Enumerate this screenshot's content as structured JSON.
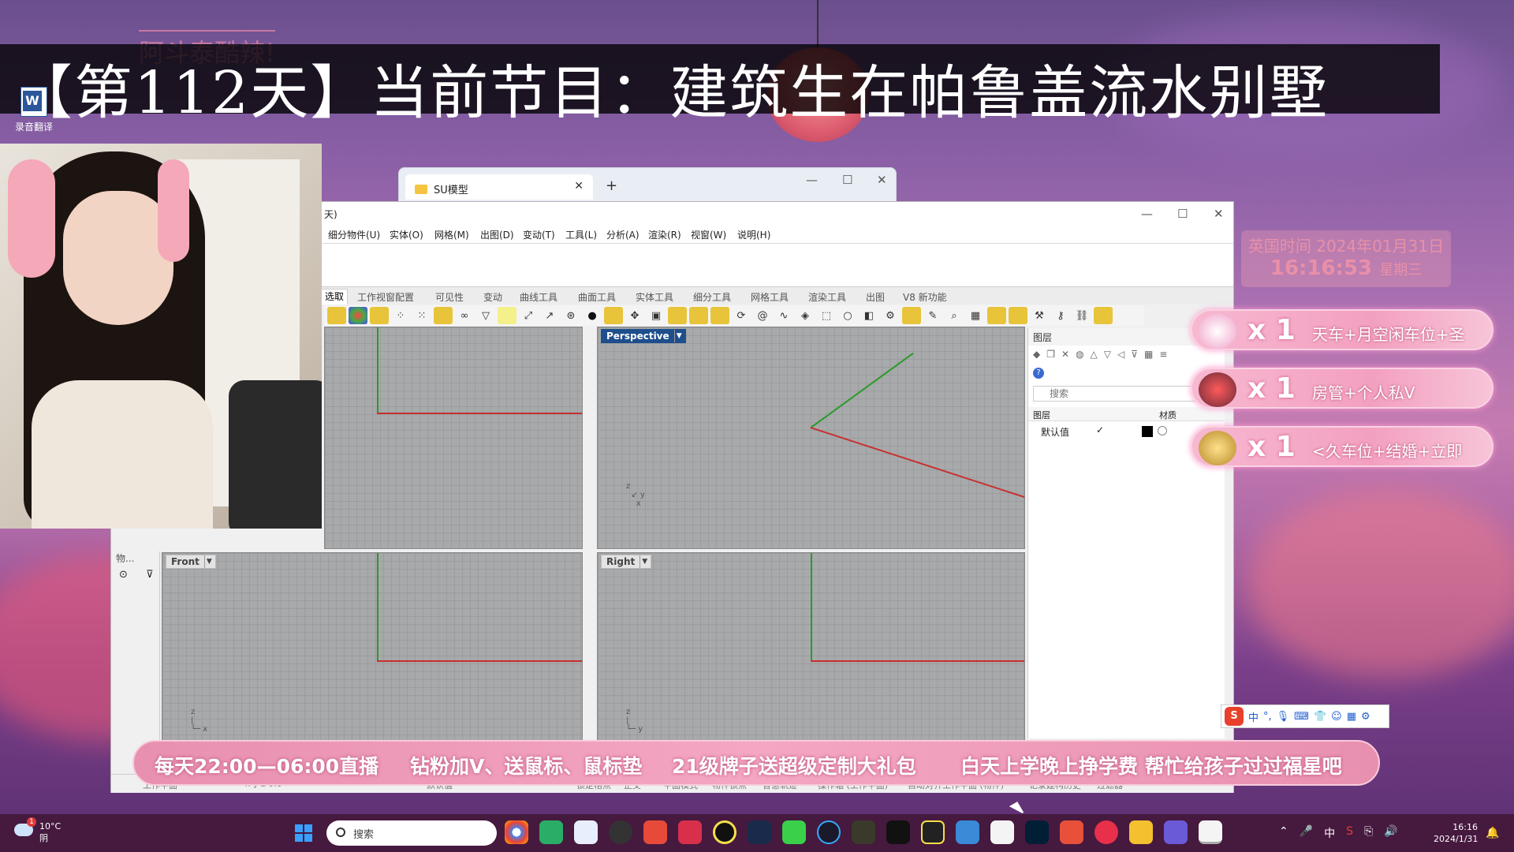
{
  "overlay": {
    "title": "【第112天】当前节目：建筑生在帕鲁盖流水别墅",
    "subtitle": "阿斗泰酷辣!"
  },
  "desktop": {
    "icon_label": "录音翻译"
  },
  "explorer": {
    "tab_label": "SU模型",
    "new_tab": "+",
    "minimize": "—",
    "maximize": "☐",
    "close": "✕"
  },
  "rhino": {
    "title_fragment": "天)",
    "menus": [
      "细分物件(U)",
      "实体(O)",
      "网格(M)",
      "出图(D)",
      "变动(T)",
      "工具(L)",
      "分析(A)",
      "渲染(R)",
      "视窗(W)",
      "说明(H)"
    ],
    "tabs": [
      "选取",
      "工作视窗配置",
      "可见性",
      "变动",
      "曲线工具",
      "曲面工具",
      "实体工具",
      "细分工具",
      "网格工具",
      "渲染工具",
      "出图",
      "V8 新功能"
    ],
    "viewports": {
      "top_left": "",
      "perspective": "Perspective",
      "front": "Front",
      "right": "Right"
    },
    "side_panel_label": "物...",
    "layers": {
      "header": "图层",
      "search_placeholder": "搜索",
      "col_layer": "图层",
      "col_material": "材质",
      "default_layer": "默认值",
      "check": "✓"
    },
    "status": [
      "工作平面",
      "x y z  0.0",
      "默认值",
      "锁定格点",
      "正交",
      "平面模式",
      "物件锁点",
      "智慧轨迹",
      "操作轴 (工作平面)",
      "自动对齐工作平面 (物件)",
      "记录建构历史",
      "过滤器"
    ]
  },
  "datetime": {
    "line1": "英国时间 2024年01月31日",
    "time": "16:16:53",
    "weekday": "星期三"
  },
  "gifts": [
    {
      "count": "x 1",
      "text": "天车+月空闲车位+圣"
    },
    {
      "count": "x 1",
      "text": "房管+个人私V"
    },
    {
      "count": "x 1",
      "text": "<久车位+结婚+立即"
    }
  ],
  "ime": {
    "label": "中"
  },
  "ticker": [
    "每天22:00—06:00直播",
    "钻粉加V、送鼠标、鼠标垫",
    "21级牌子送超级定制大礼包",
    "白天上学晚上挣学费 帮忙给孩子过过福星吧"
  ],
  "taskbar": {
    "weather_temp": "10°C",
    "weather_desc": "阴",
    "weather_badge": "1",
    "search_placeholder": "搜索",
    "lang": "中",
    "time": "16:16",
    "date": "2024/1/31"
  },
  "colors": {
    "axis_green": "#2a9a2a",
    "axis_red": "#c83030",
    "active_viewport": "#1e4e8c",
    "ticker_pink": "#f4a6c2"
  }
}
